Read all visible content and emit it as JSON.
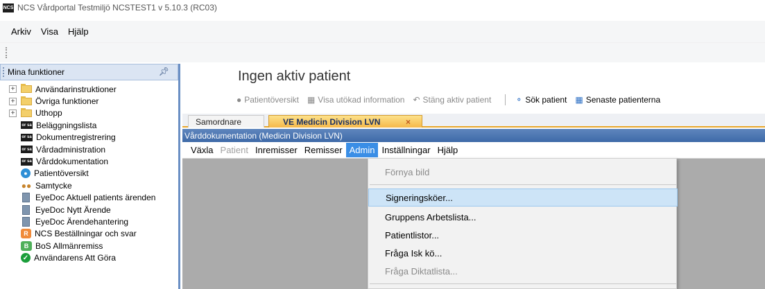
{
  "window": {
    "app_icon": "NCS",
    "title": "NCS Vårdportal Testmiljö NCSTEST1 v 5.10.3 (RC03)"
  },
  "menubar": [
    "Arkiv",
    "Visa",
    "Hjälp"
  ],
  "left_panel": {
    "title": "Mina funktioner",
    "pin_icon": "pin-icon",
    "items": [
      {
        "label": "Användarinstruktioner",
        "icon": "folder-icon",
        "expandable": true
      },
      {
        "label": "Övriga funktioner",
        "icon": "folder-icon",
        "expandable": true
      },
      {
        "label": "Uthopp",
        "icon": "folder-icon",
        "expandable": true
      },
      {
        "label": "Beläggningslista",
        "icon": "ncs-icon"
      },
      {
        "label": "Dokumentregistrering",
        "icon": "ncs-icon"
      },
      {
        "label": "Vårdadministration",
        "icon": "ncs-icon"
      },
      {
        "label": "Vårddokumentation",
        "icon": "ncs-icon"
      },
      {
        "label": "Patientöversikt",
        "icon": "person-icon"
      },
      {
        "label": "Samtycke",
        "icon": "group-icon"
      },
      {
        "label": "EyeDoc Aktuell patients ärenden",
        "icon": "document-icon"
      },
      {
        "label": "EyeDoc Nytt Ärende",
        "icon": "document-icon"
      },
      {
        "label": "EyeDoc Ärendehantering",
        "icon": "document-icon"
      },
      {
        "label": "NCS Beställningar och svar",
        "icon": "r-icon"
      },
      {
        "label": "BoS Allmänremiss",
        "icon": "bos-icon"
      },
      {
        "label": "Användarens Att Göra",
        "icon": "check-icon"
      }
    ]
  },
  "main": {
    "heading": "Ingen aktiv patient",
    "toolbar": {
      "patientoversikt": "Patientöversikt",
      "visa_utokad": "Visa utökad information",
      "stang_aktiv": "Stäng aktiv patient",
      "sok_patient": "Sök patient",
      "senaste_patienterna": "Senaste patienterna"
    },
    "tabs": {
      "inactive": "Samordnare",
      "active": "VE Medicin Division LVN",
      "close": "×"
    },
    "panel_title": "Vårddokumentation (Medicin Division LVN)",
    "submenu": [
      "Växla",
      "Patient",
      "Inremisser",
      "Remisser",
      "Admin",
      "Inställningar",
      "Hjälp"
    ],
    "dropdown": [
      "Förnya bild",
      "Signeringsköer...",
      "Gruppens Arbetslista...",
      "Patientlistor...",
      "Fråga Isk kö...",
      "Fråga Diktatlista..."
    ]
  },
  "colors": {
    "accent": "#3a8ee6",
    "tab_active": "#f5b84a",
    "panel_title_bar": "#4a73ad",
    "content_bg": "#ababab",
    "highlight": "#cde4f7"
  }
}
